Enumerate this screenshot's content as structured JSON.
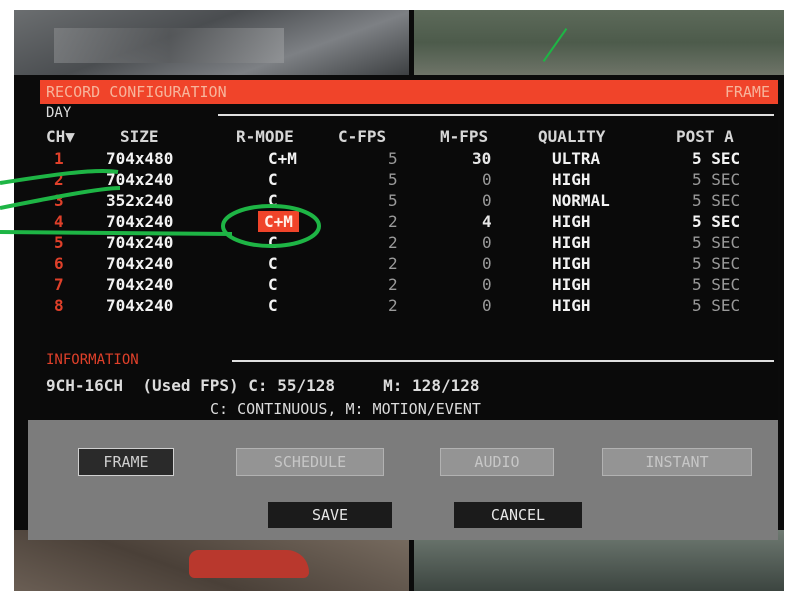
{
  "window": {
    "title": "RECORD CONFIGURATION",
    "mode": "FRAME",
    "day_label": "DAY"
  },
  "table": {
    "headers": {
      "ch": "CH▼",
      "size": "SIZE",
      "rmode": "R-MODE",
      "cfps": "C-FPS",
      "mfps": "M-FPS",
      "quality": "QUALITY",
      "post": "POST A"
    },
    "rows": [
      {
        "ch": "1",
        "size": "704x480",
        "rmode": "C+M",
        "cfps": "5",
        "mfps": "30",
        "quality": "ULTRA",
        "post": "5 SEC"
      },
      {
        "ch": "2",
        "size": "704x240",
        "rmode": "C",
        "cfps": "5",
        "mfps": "0",
        "quality": "HIGH",
        "post": "5 SEC"
      },
      {
        "ch": "3",
        "size": "352x240",
        "rmode": "C",
        "cfps": "5",
        "mfps": "0",
        "quality": "NORMAL",
        "post": "5 SEC"
      },
      {
        "ch": "4",
        "size": "704x240",
        "rmode": "C+M",
        "cfps": "2",
        "mfps": "4",
        "quality": "HIGH",
        "post": "5 SEC"
      },
      {
        "ch": "5",
        "size": "704x240",
        "rmode": "C",
        "cfps": "2",
        "mfps": "0",
        "quality": "HIGH",
        "post": "5 SEC"
      },
      {
        "ch": "6",
        "size": "704x240",
        "rmode": "C",
        "cfps": "2",
        "mfps": "0",
        "quality": "HIGH",
        "post": "5 SEC"
      },
      {
        "ch": "7",
        "size": "704x240",
        "rmode": "C",
        "cfps": "2",
        "mfps": "0",
        "quality": "HIGH",
        "post": "5 SEC"
      },
      {
        "ch": "8",
        "size": "704x240",
        "rmode": "C",
        "cfps": "2",
        "mfps": "0",
        "quality": "HIGH",
        "post": "5 SEC"
      }
    ]
  },
  "information": {
    "label": "INFORMATION",
    "line1": "9CH-16CH  (Used FPS) C: 55/128     M: 128/128",
    "line2": "C: CONTINUOUS, M: MOTION/EVENT"
  },
  "tabs": [
    "FRAME",
    "SCHEDULE",
    "AUDIO",
    "INSTANT"
  ],
  "actions": {
    "save": "SAVE",
    "cancel": "CANCEL"
  },
  "colors": {
    "accent": "#f0442a",
    "annotation": "#1eb545",
    "button_bar": "#7c7c7c"
  }
}
